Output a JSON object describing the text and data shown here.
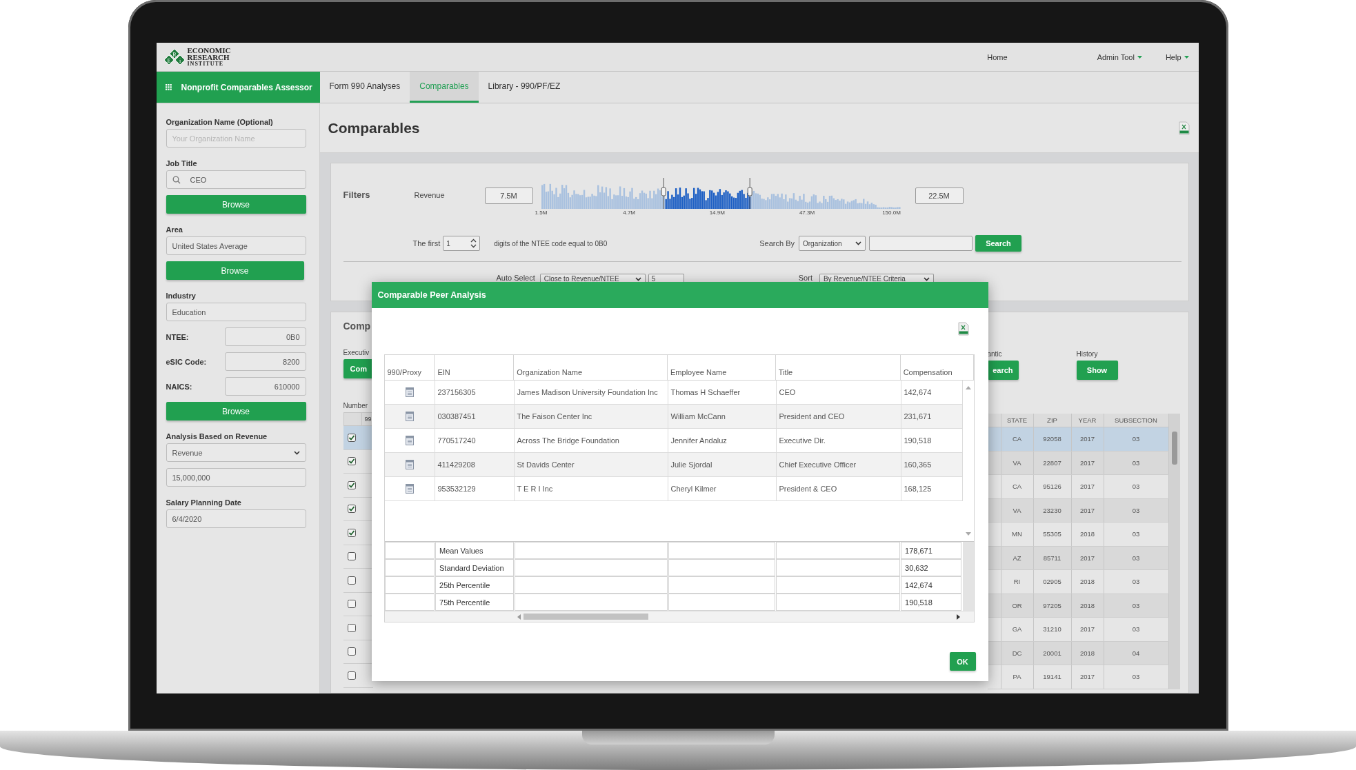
{
  "logo": {
    "marks": [
      "E",
      "R",
      "i"
    ],
    "lines": [
      "ECONOMIC",
      "RESEARCH",
      "INSTITUTE"
    ]
  },
  "top_nav": [
    {
      "label": "Home",
      "dropdown": false
    },
    {
      "label": "Admin Tool",
      "dropdown": true
    },
    {
      "label": "Help",
      "dropdown": true
    }
  ],
  "app_name": "Nonprofit Comparables Assessor",
  "tabs": [
    {
      "label": "Form 990 Analyses",
      "selected": false
    },
    {
      "label": "Comparables",
      "selected": true
    },
    {
      "label": "Library - 990/PF/EZ",
      "selected": false
    }
  ],
  "sidebar": [
    {
      "kind": "field",
      "label": "Organization Name (Optional)",
      "placeholder": "Your Organization Name"
    },
    {
      "kind": "search",
      "label": "Job Title",
      "value": "CEO"
    },
    {
      "kind": "button",
      "label": "Browse"
    },
    {
      "kind": "field",
      "label": "Area",
      "value": "United States Average"
    },
    {
      "kind": "button",
      "label": "Browse"
    },
    {
      "kind": "field",
      "label": "Industry",
      "value": "Education"
    },
    {
      "kind": "inline",
      "label": "NTEE:",
      "value": "0B0"
    },
    {
      "kind": "inline",
      "label": "eSIC Code:",
      "value": "8200"
    },
    {
      "kind": "inline",
      "label": "NAICS:",
      "value": "610000"
    },
    {
      "kind": "button",
      "label": "Browse"
    },
    {
      "kind": "select",
      "label": "Analysis Based on Revenue",
      "value": "Revenue"
    },
    {
      "kind": "field",
      "value": "15,000,000"
    },
    {
      "kind": "field",
      "label": "Salary Planning Date",
      "value": "6/4/2020"
    }
  ],
  "page_title": "Comparables",
  "filters": {
    "title": "Filters",
    "revenue_label": "Revenue",
    "min": "7.5M",
    "max": "22.5M",
    "axis_labels": [
      "1.5M",
      "4.7M",
      "14.9M",
      "47.3M",
      "150.0M"
    ],
    "first_label": "The first",
    "first_value": "1",
    "ntee_text": "digits of the NTEE code equal to 0B0",
    "search_by_label": "Search By",
    "search_by_value": "Organization",
    "search_button": "Search",
    "auto_select_label": "Auto Select",
    "auto_select_value": "Close to Revenue/NTEE",
    "count_value": "5",
    "sort_label": "Sort",
    "sort_value": "By Revenue/NTEE Criteria"
  },
  "comparables": {
    "title": "Comp",
    "executive_label": "Executiv",
    "executive_button": "Com",
    "search_label": "antic",
    "search_button": "earch",
    "history_label": "History",
    "history_button": "Show",
    "count_label": "Number",
    "left_column": "99",
    "columns": [
      "STATE",
      "ZIP",
      "YEAR",
      "SUBSECTION"
    ],
    "rows": [
      {
        "checked": true,
        "selected": true,
        "cells": [
          "CA",
          "92058",
          "2017",
          "03"
        ]
      },
      {
        "checked": true,
        "selected": false,
        "cells": [
          "VA",
          "22807",
          "2017",
          "03"
        ]
      },
      {
        "checked": true,
        "selected": false,
        "cells": [
          "CA",
          "95126",
          "2017",
          "03"
        ]
      },
      {
        "checked": true,
        "selected": false,
        "cells": [
          "VA",
          "23230",
          "2017",
          "03"
        ]
      },
      {
        "checked": true,
        "selected": false,
        "cells": [
          "MN",
          "55305",
          "2018",
          "03"
        ]
      },
      {
        "checked": false,
        "selected": false,
        "cells": [
          "AZ",
          "85711",
          "2017",
          "03"
        ]
      },
      {
        "checked": false,
        "selected": false,
        "cells": [
          "RI",
          "02905",
          "2018",
          "03"
        ]
      },
      {
        "checked": false,
        "selected": false,
        "cells": [
          "OR",
          "97205",
          "2018",
          "03"
        ]
      },
      {
        "checked": false,
        "selected": false,
        "cells": [
          "GA",
          "31210",
          "2017",
          "03"
        ]
      },
      {
        "checked": false,
        "selected": false,
        "cells": [
          "DC",
          "20001",
          "2018",
          "04"
        ]
      },
      {
        "checked": false,
        "selected": false,
        "cells": [
          "PA",
          "19141",
          "2017",
          "03"
        ]
      }
    ]
  },
  "modal": {
    "title": "Comparable Peer Analysis",
    "columns": [
      "990/Proxy",
      "EIN",
      "Organization Name",
      "Employee Name",
      "Title",
      "Compensation"
    ],
    "rows": [
      {
        "cells": [
          "",
          "237156305",
          "James Madison University Foundation Inc",
          "Thomas H Schaeffer",
          "CEO",
          "142,674"
        ]
      },
      {
        "cells": [
          "",
          "030387451",
          "The Faison Center Inc",
          "William McCann",
          "President and CEO",
          "231,671"
        ]
      },
      {
        "cells": [
          "",
          "770517240",
          "Across The Bridge Foundation",
          "Jennifer Andaluz",
          "Executive Dir.",
          "190,518"
        ]
      },
      {
        "cells": [
          "",
          "411429208",
          "St Davids Center",
          "Julie Sjordal",
          "Chief Executive Officer",
          "160,365"
        ]
      },
      {
        "cells": [
          "",
          "953532129",
          "T E R I Inc",
          "Cheryl Kilmer",
          "President & CEO",
          "168,125"
        ]
      }
    ],
    "summary": [
      {
        "label": "Mean Values",
        "value": "178,671"
      },
      {
        "label": "Standard Deviation",
        "value": "30,632"
      },
      {
        "label": "25th Percentile",
        "value": "142,674"
      },
      {
        "label": "75th Percentile",
        "value": "190,518"
      }
    ],
    "ok": "OK"
  }
}
